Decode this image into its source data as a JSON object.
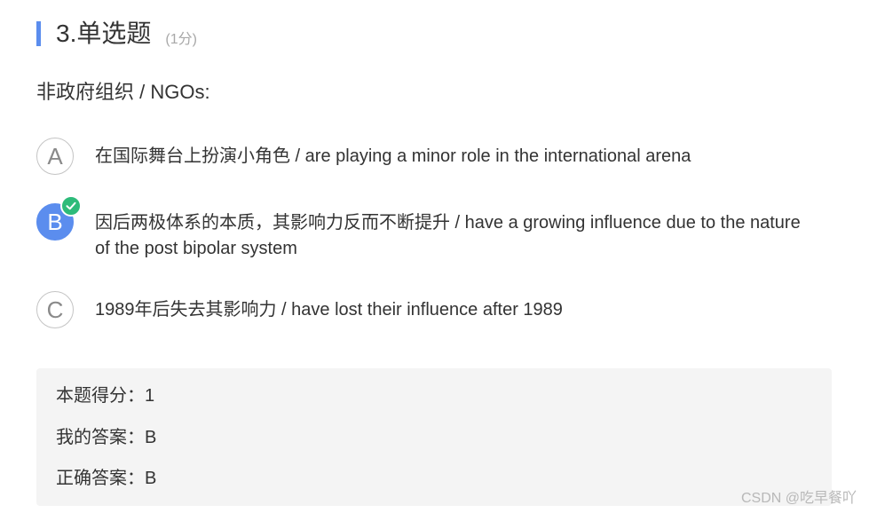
{
  "header": {
    "title": "3.单选题",
    "score": "(1分)",
    "accent_color": "#5b8dee"
  },
  "question": {
    "text": "非政府组织 / NGOs:"
  },
  "options": [
    {
      "letter": "A",
      "text": "在国际舞台上扮演小角色 / are playing a minor role in the international arena",
      "selected": false
    },
    {
      "letter": "B",
      "text": "因后两极体系的本质，其影响力反而不断提升 / have a growing influence due to the nature of the post bipolar system",
      "selected": true,
      "badge_icon": "check-icon",
      "badge_color": "#2dbb7a"
    },
    {
      "letter": "C",
      "text": "1989年后失去其影响力 / have lost their influence after 1989",
      "selected": false
    }
  ],
  "result": {
    "score_line": "本题得分：1",
    "my_answer_line": "我的答案：B",
    "correct_answer_line": "正确答案：B"
  },
  "watermark": "CSDN @吃早餐吖"
}
